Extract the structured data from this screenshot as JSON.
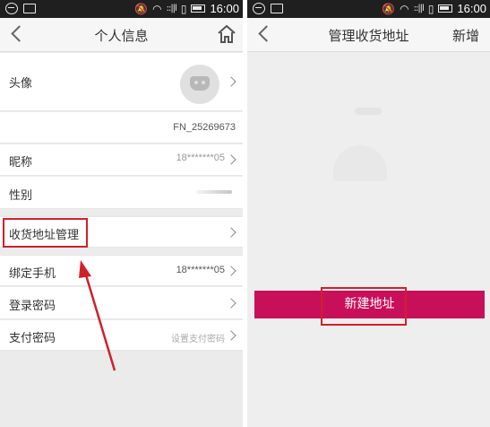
{
  "left_screen": {
    "status_bar": {
      "time": "16:00"
    },
    "nav": {
      "title": "个人信息"
    },
    "rows": [
      {
        "label": "头像",
        "value": ""
      },
      {
        "label": "",
        "value": "FN_25269673"
      },
      {
        "label": "昵称",
        "value": "18*******05"
      },
      {
        "label": "性别",
        "value": ""
      },
      {
        "label": "收货地址管理",
        "value": ""
      },
      {
        "label": "绑定手机",
        "value": "18*******05"
      },
      {
        "label": "登录密码",
        "value": ""
      },
      {
        "label": "支付密码",
        "value": "设置支付密码"
      }
    ]
  },
  "right_screen": {
    "status_bar": {
      "time": "16:00"
    },
    "nav": {
      "title": "管理收货地址",
      "action": "新增"
    },
    "new_address_button": "新建地址"
  },
  "colors": {
    "accent": "#c8105a",
    "annotation_red": "#d0202a",
    "status_bar": "#1f1f1f"
  }
}
